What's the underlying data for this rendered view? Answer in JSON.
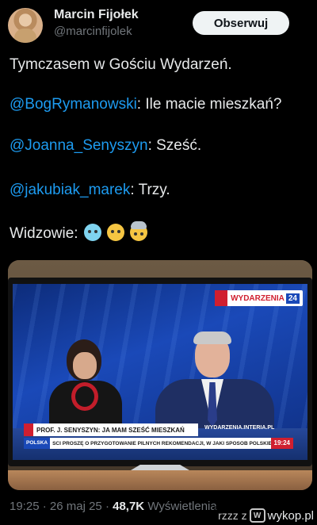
{
  "author": {
    "name": "Marcin Fijołek",
    "handle": "@marcinfijolek",
    "follow_label": "Obserwuj"
  },
  "tweet": {
    "line1": "Tymczasem w Gościu Wydarzeń.",
    "line2": {
      "mention": "@BogRymanowski",
      "text": ": Ile macie mieszkań?"
    },
    "line3": {
      "mention": "@Joanna_Senyszyn",
      "text": ": Sześć."
    },
    "line4": {
      "mention": "@jakubiak_marek",
      "text": ": Trzy."
    },
    "line5": "Widzowie:",
    "emojis": [
      "cold-face-emoji",
      "screaming-face-emoji",
      "exploding-head-emoji"
    ]
  },
  "tv_screen": {
    "channel_logo": "WYDARZENIA",
    "channel_number": "24",
    "lower_third_main": "PROF. J. SENYSZYN: JA MAM SZEŚĆ MIESZKAŃ",
    "website": "WYDARZENIA.INTERIA.PL",
    "ticker_section": "POLSKA",
    "ticker_text": "ŚCI PROSZĘ O PRZYGOTOWANIE PILNYCH REKOMENDACJI, W JAKI SPOSÓB POLSKIE",
    "clock": "19:24"
  },
  "meta": {
    "time": "19:25",
    "separator": "·",
    "date": "26 maj 25",
    "views_count": "48,7K",
    "views_label": "Wyświetlenia"
  },
  "watermark": {
    "left": "rzzz z",
    "site": "wykop.pl"
  },
  "colors": {
    "background": "#000000",
    "mention": "#1d9bf0",
    "text": "#e7e9ea",
    "secondary": "#71767b",
    "follow_bg": "#eff3f4"
  }
}
